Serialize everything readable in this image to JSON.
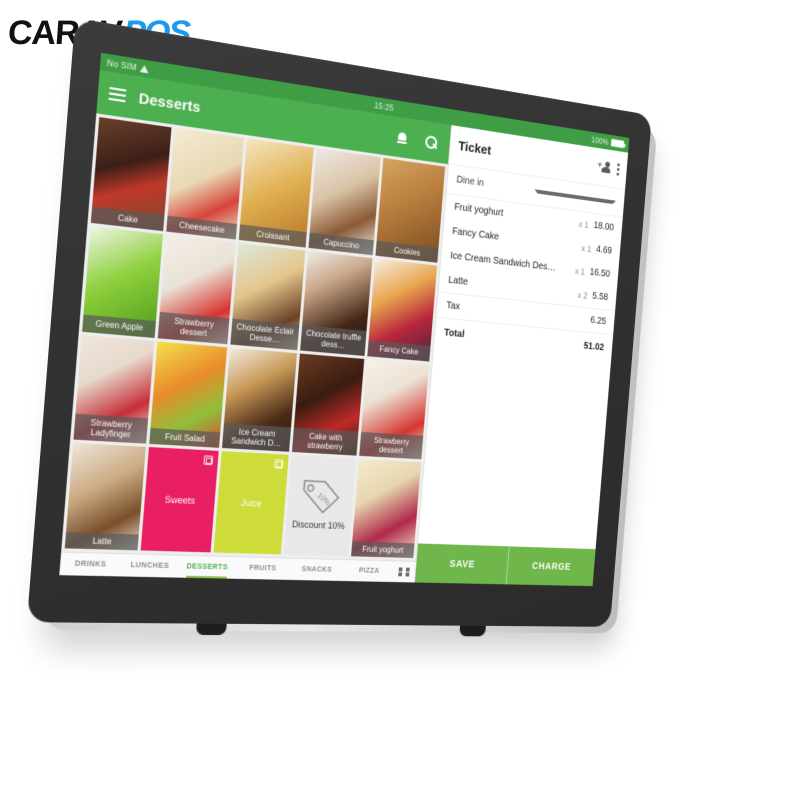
{
  "brand": {
    "part1": "CARAV",
    "part2": "POS"
  },
  "device": {
    "status_bar": {
      "sim_text": "No SIM",
      "wifi_icon": "wifi-icon",
      "time": "15:25",
      "battery_text": "100%",
      "battery_icon": "battery-icon"
    },
    "appbar": {
      "menu_icon": "hamburger-menu-icon",
      "title": "Desserts",
      "bell_icon": "bell-icon",
      "search_icon": "search-icon"
    },
    "products": [
      {
        "label": "Cake",
        "style": "f-cake",
        "kind": "photo"
      },
      {
        "label": "Cheesecake",
        "style": "f-cheesecake",
        "kind": "photo"
      },
      {
        "label": "Croissant",
        "style": "f-croissant2",
        "kind": "photo"
      },
      {
        "label": "Capuccino",
        "style": "f-capuccino",
        "kind": "photo"
      },
      {
        "label": "Cookies",
        "style": "f-cookies",
        "kind": "photo"
      },
      {
        "label": "Green Apple",
        "style": "f-apple",
        "kind": "photo"
      },
      {
        "label": "Strawberry dessert",
        "style": "f-strawdess",
        "kind": "photo"
      },
      {
        "label": "Chocolate Eclair Desse…",
        "style": "f-eclair",
        "kind": "photo"
      },
      {
        "label": "Chocolate truffle dess…",
        "style": "f-truffle",
        "kind": "photo"
      },
      {
        "label": "Fancy Cake",
        "style": "f-fancycake",
        "kind": "photo"
      },
      {
        "label": "Strawberry Ladyfinger",
        "style": "f-ladyfinger",
        "kind": "photo"
      },
      {
        "label": "Fruit Salad",
        "style": "f-fruitsalad",
        "kind": "photo"
      },
      {
        "label": "Ice Cream Sandwich D…",
        "style": "f-icsand",
        "kind": "photo"
      },
      {
        "label": "Cake with strawberry",
        "style": "f-cakestraw",
        "kind": "photo"
      },
      {
        "label": "Strawberry dessert",
        "style": "f-strawdess2",
        "kind": "photo"
      },
      {
        "label": "Latte",
        "style": "f-latte",
        "kind": "photo"
      },
      {
        "label": "Sweets",
        "style": "t-sweets",
        "kind": "category",
        "color": "#E91E63",
        "icon": "folder-icon"
      },
      {
        "label": "Juice",
        "style": "t-juice",
        "kind": "category",
        "color": "#CDDC39",
        "icon": "folder-icon"
      },
      {
        "label": "Discount 10%",
        "style": "discount",
        "kind": "discount",
        "icon": "price-tag-icon",
        "tag_text": "10%"
      },
      {
        "label": "Fruit yoghurt",
        "style": "f-yoghurt",
        "kind": "photo"
      }
    ],
    "tabs": [
      {
        "label": "DRINKS",
        "active": false
      },
      {
        "label": "LUNCHES",
        "active": false
      },
      {
        "label": "DESSERTS",
        "active": true
      },
      {
        "label": "FRUITS",
        "active": false
      },
      {
        "label": "SNACKS",
        "active": false
      },
      {
        "label": "PIZZA",
        "active": false
      }
    ],
    "tabs_overflow_icon": "grid-view-icon",
    "ticket": {
      "title": "Ticket",
      "add_person_icon": "add-person-icon",
      "overflow_icon": "more-vertical-icon",
      "order_type": "Dine in",
      "order_type_caret": "chevron-down-icon",
      "lines": [
        {
          "name": "Fruit yoghurt",
          "qty": "x 1",
          "amount": "18.00"
        },
        {
          "name": "Fancy Cake",
          "qty": "x 1",
          "amount": "4.69"
        },
        {
          "name": "Ice Cream Sandwich Des…",
          "qty": "x 1",
          "amount": "16.50"
        },
        {
          "name": "Latte",
          "qty": "x 2",
          "amount": "5.58"
        }
      ],
      "tax_label": "Tax",
      "tax_amount": "6.25",
      "total_label": "Total",
      "total_amount": "51.02",
      "save_label": "SAVE",
      "charge_label": "CHARGE"
    }
  },
  "colors": {
    "accent_green": "#4CAF50",
    "status_green": "#3f9e45",
    "button_green": "#6FB64B",
    "brand_blue": "#1a9bef",
    "bezel": "#333333"
  }
}
